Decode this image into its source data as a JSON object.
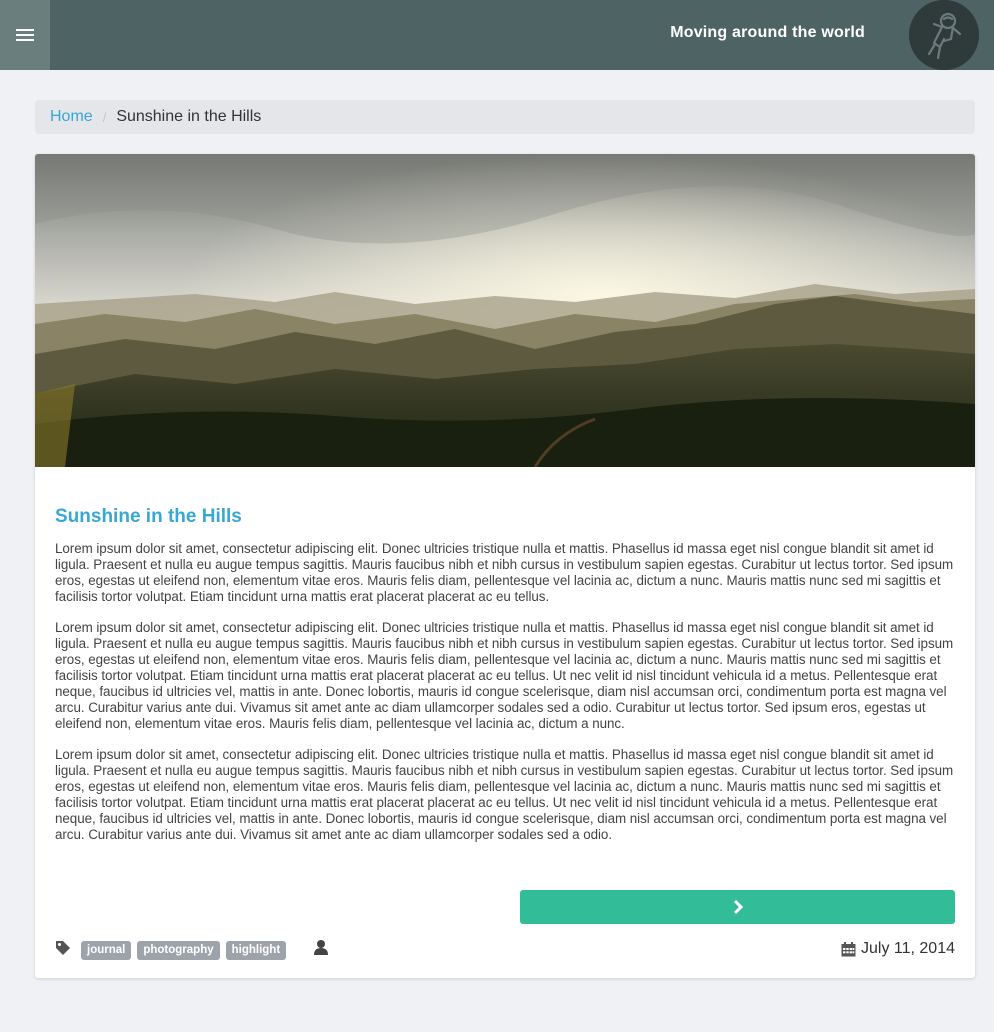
{
  "header": {
    "site_title": "Moving around the world",
    "menu_icon": "hamburger-menu-icon",
    "avatar_icon": "astronaut-icon"
  },
  "breadcrumb": {
    "home": "Home",
    "separator": "/",
    "current": "Sunshine in the Hills"
  },
  "post": {
    "hero_image": "mountain-landscape",
    "title": "Sunshine in the Hills",
    "paragraphs": [
      "Lorem ipsum dolor sit amet, consectetur adipiscing elit. Donec ultricies tristique nulla et mattis. Phasellus id massa eget nisl congue blandit sit amet id ligula. Praesent et nulla eu augue tempus sagittis. Mauris faucibus nibh et nibh cursus in vestibulum sapien egestas. Curabitur ut lectus tortor. Sed ipsum eros, egestas ut eleifend non, elementum vitae eros. Mauris felis diam, pellentesque vel lacinia ac, dictum a nunc. Mauris mattis nunc sed mi sagittis et facilisis tortor volutpat. Etiam tincidunt urna mattis erat placerat placerat ac eu tellus.",
      "Lorem ipsum dolor sit amet, consectetur adipiscing elit. Donec ultricies tristique nulla et mattis. Phasellus id massa eget nisl congue blandit sit amet id ligula. Praesent et nulla eu augue tempus sagittis. Mauris faucibus nibh et nibh cursus in vestibulum sapien egestas. Curabitur ut lectus tortor. Sed ipsum eros, egestas ut eleifend non, elementum vitae eros. Mauris felis diam, pellentesque vel lacinia ac, dictum a nunc. Mauris mattis nunc sed mi sagittis et facilisis tortor volutpat. Etiam tincidunt urna mattis erat placerat placerat ac eu tellus. Ut nec velit id nisl tincidunt vehicula id a metus. Pellentesque erat neque, faucibus id ultricies vel, mattis in ante. Donec lobortis, mauris id congue scelerisque, diam nisl accumsan orci, condimentum porta est magna vel arcu. Curabitur varius ante dui. Vivamus sit amet ante ac diam ullamcorper sodales sed a odio. Curabitur ut lectus tortor. Sed ipsum eros, egestas ut eleifend non, elementum vitae eros. Mauris felis diam, pellentesque vel lacinia ac, dictum a nunc.",
      "Lorem ipsum dolor sit amet, consectetur adipiscing elit. Donec ultricies tristique nulla et mattis. Phasellus id massa eget nisl congue blandit sit amet id ligula. Praesent et nulla eu augue tempus sagittis. Mauris faucibus nibh et nibh cursus in vestibulum sapien egestas. Curabitur ut lectus tortor. Sed ipsum eros, egestas ut eleifend non, elementum vitae eros. Mauris felis diam, pellentesque vel lacinia ac, dictum a nunc. Mauris mattis nunc sed mi sagittis et facilisis tortor volutpat. Etiam tincidunt urna mattis erat placerat placerat ac eu tellus. Ut nec velit id nisl tincidunt vehicula id a metus. Pellentesque erat neque, faucibus id ultricies vel, mattis in ante. Donec lobortis, mauris id congue scelerisque, diam nisl accumsan orci, condimentum porta est magna vel arcu. Curabitur varius ante dui. Vivamus sit amet ante ac diam ullamcorper sodales sed a odio."
    ],
    "next_icon": "chevron-right-icon",
    "tags": [
      "journal",
      "photography",
      "highlight"
    ],
    "date": "July 11, 2014"
  },
  "colors": {
    "header_bg": "#4e6464",
    "menu_bg": "#6a7f7d",
    "accent": "#38a8d3",
    "button": "#33bc98",
    "tag_bg": "#9ea3a9",
    "page_bg": "#eff1f4"
  }
}
